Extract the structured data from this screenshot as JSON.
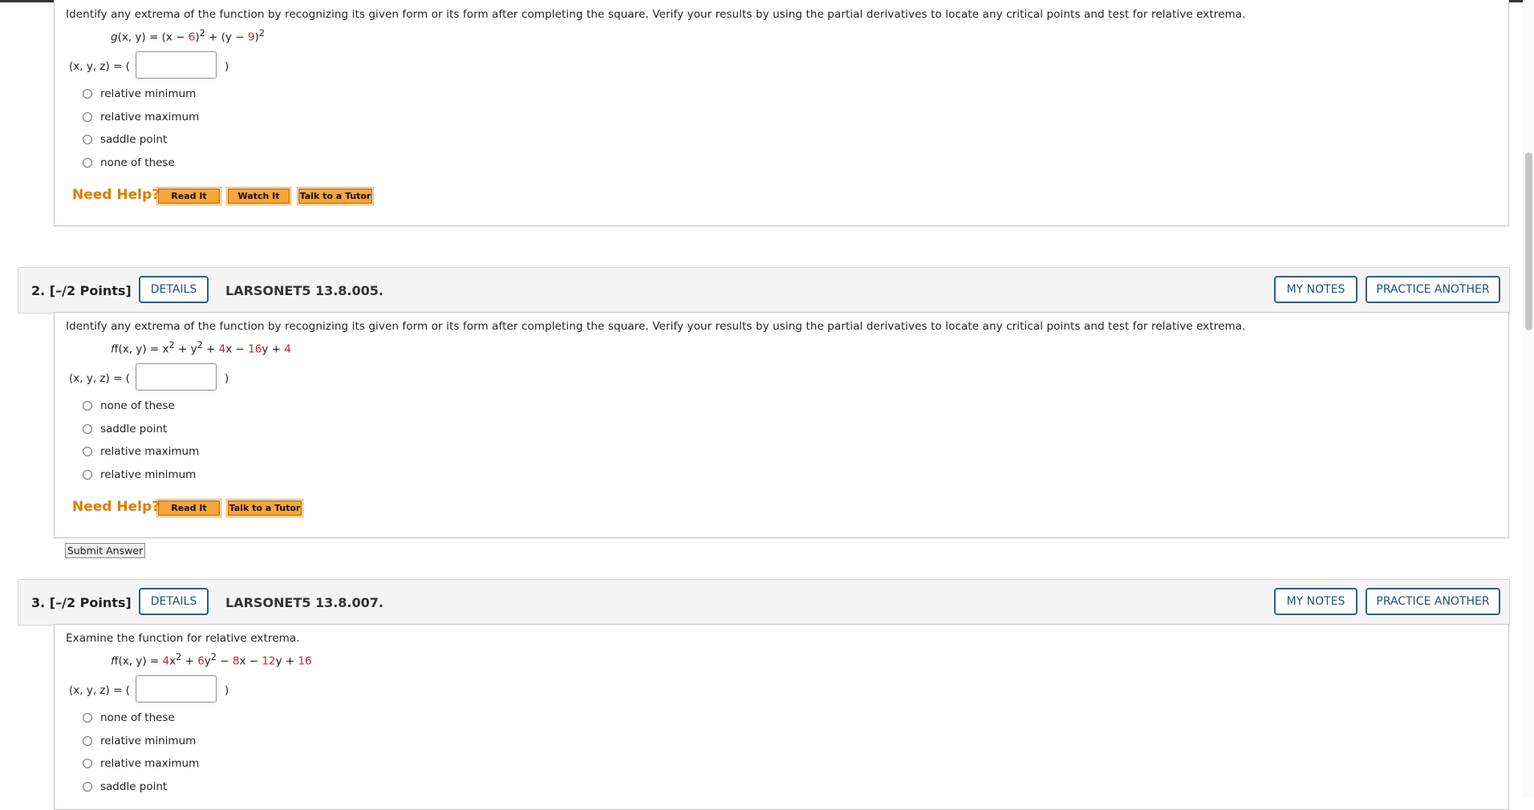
{
  "q1": {
    "prompt": "Identify any extrema of the function by recognizing its given form or its form after completing the square. Verify your results by using the partial derivatives to locate any critical points and test for relative extrema.",
    "function": {
      "name": "g",
      "lhs_args": "(x, y) = (x − ",
      "c1": "6",
      "mid": ")",
      "sup1": "2",
      "plus": " + (y − ",
      "c2": "9",
      "close": ")",
      "sup2": "2"
    },
    "xyz_label": "(x, y, z) = (",
    "xyz_close": ")",
    "options": [
      "relative minimum",
      "relative maximum",
      "saddle point",
      "none of these"
    ],
    "need_help": "Need Help?",
    "help_buttons": [
      "Read It",
      "Watch It",
      "Talk to a Tutor"
    ]
  },
  "q2": {
    "number": "2.",
    "points": "[–/2 Points]",
    "details_label": "DETAILS",
    "id": "LARSONET5 13.8.005.",
    "my_notes": "MY NOTES",
    "practice_another": "PRACTICE ANOTHER",
    "prompt": "Identify any extrema of the function by recognizing its given form or its form after completing the square. Verify your results by using the partial derivatives to locate any critical points and test for relative extrema.",
    "function": {
      "lhs": "f(x, y) = x",
      "sup1": "2",
      "p1": " + y",
      "sup2": "2",
      "p2": " + ",
      "c1": "4",
      "p3": "x − ",
      "c2": "16",
      "p4": "y + ",
      "c3": "4"
    },
    "xyz_label": "(x, y, z) = (",
    "xyz_close": ")",
    "options": [
      "none of these",
      "saddle point",
      "relative maximum",
      "relative minimum"
    ],
    "need_help": "Need Help?",
    "help_buttons": [
      "Read It",
      "Talk to a Tutor"
    ],
    "submit_label": "Submit Answer"
  },
  "q3": {
    "number": "3.",
    "points": "[–/2 Points]",
    "details_label": "DETAILS",
    "id": "LARSONET5 13.8.007.",
    "my_notes": "MY NOTES",
    "practice_another": "PRACTICE ANOTHER",
    "prompt": "Examine the function for relative extrema.",
    "function": {
      "lhs": "f(x, y) = ",
      "c1": "4",
      "p1": "x",
      "sup1": "2",
      "p2": " + ",
      "c2": "6",
      "p3": "y",
      "sup2": "2",
      "p4": " − ",
      "c3": "8",
      "p5": "x − ",
      "c4": "12",
      "p6": "y + ",
      "c5": "16"
    },
    "xyz_label": "(x, y, z) = (",
    "xyz_close": ")",
    "options": [
      "none of these",
      "relative minimum",
      "relative maximum",
      "saddle point"
    ]
  },
  "colors": {
    "accent_orange": "#e07b00",
    "button_orange": "#f7a43a",
    "link_blue": "#1f4f80",
    "constant_red": "#d32020"
  }
}
